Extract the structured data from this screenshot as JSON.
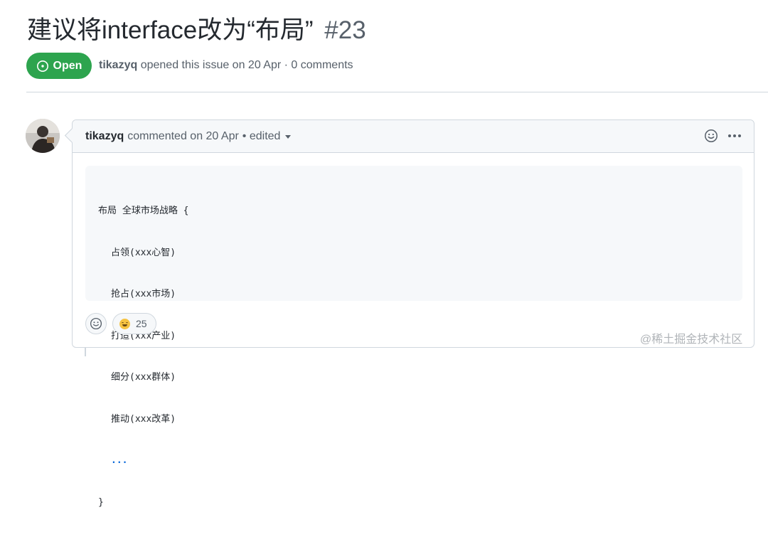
{
  "issue": {
    "title": "建议将interface改为“布局”",
    "number": "#23",
    "state": "Open",
    "author": "tikazyq",
    "meta_text": "opened this issue on 20 Apr · 0 comments"
  },
  "comment": {
    "author": "tikazyq",
    "action_text": "commented on 20 Apr",
    "edited_label": "• edited",
    "code_lines": [
      "布局 全球市场战略 {",
      "占领(xxx心智)",
      "抢占(xxx市场)",
      "打造(xxx产业)",
      "细分(xxx群体)",
      "推动(xxx改革)",
      "...",
      "}"
    ],
    "reactions": [
      {
        "emoji": "grinning-face",
        "count": "25"
      }
    ]
  },
  "watermark": "@稀土掘金技术社区",
  "colors": {
    "open_green": "#2da44e",
    "muted_text": "#57606a",
    "border": "#d0d7de",
    "link_blue": "#0969da"
  }
}
